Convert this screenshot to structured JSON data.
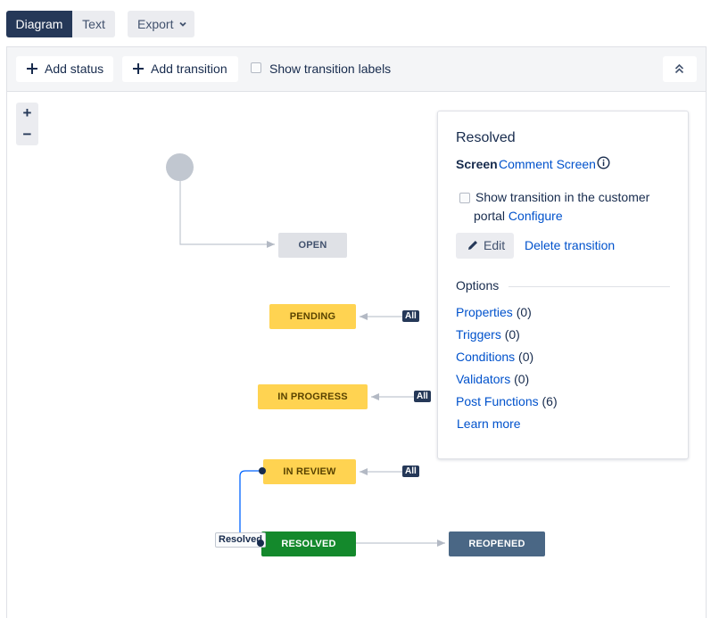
{
  "view_switch": {
    "diagram": "Diagram",
    "text": "Text",
    "export": "Export"
  },
  "toolbar": {
    "add_status": "Add status",
    "add_transition": "Add transition",
    "show_labels": "Show transition labels",
    "show_labels_checked": false
  },
  "zoom": {
    "in": "+",
    "out": "−"
  },
  "statuses": {
    "open": "OPEN",
    "pending": "PENDING",
    "in_progress": "IN PROGRESS",
    "in_review": "IN REVIEW",
    "resolved": "RESOLVED",
    "reopened": "REOPENED"
  },
  "global_transition_badge": "All",
  "transition_label": "Resolved",
  "colors": {
    "todo": "#dfe1e6",
    "in_progress": "#ffd351",
    "done": "#14892c",
    "reopened": "#4a6785",
    "link": "#0052cc",
    "selected_transition": "#0065ff"
  },
  "panel": {
    "title": "Resolved",
    "screen_key": "Screen",
    "screen_value": "Comment Screen",
    "customer_portal_line1": "Show transition in the customer",
    "customer_portal_line2": "portal",
    "configure": "Configure",
    "customer_portal_checked": false,
    "edit": "Edit",
    "delete": "Delete transition",
    "options_heading": "Options",
    "options": [
      {
        "label": "Properties",
        "count": "(0)"
      },
      {
        "label": "Triggers",
        "count": "(0)"
      },
      {
        "label": "Conditions",
        "count": "(0)"
      },
      {
        "label": "Validators",
        "count": "(0)"
      },
      {
        "label": "Post Functions",
        "count": "(6)"
      }
    ],
    "learn_more": "Learn more"
  },
  "icons": [
    "plus-icon",
    "chevron-down-icon",
    "collapse-icon",
    "info-icon",
    "pencil-icon"
  ]
}
